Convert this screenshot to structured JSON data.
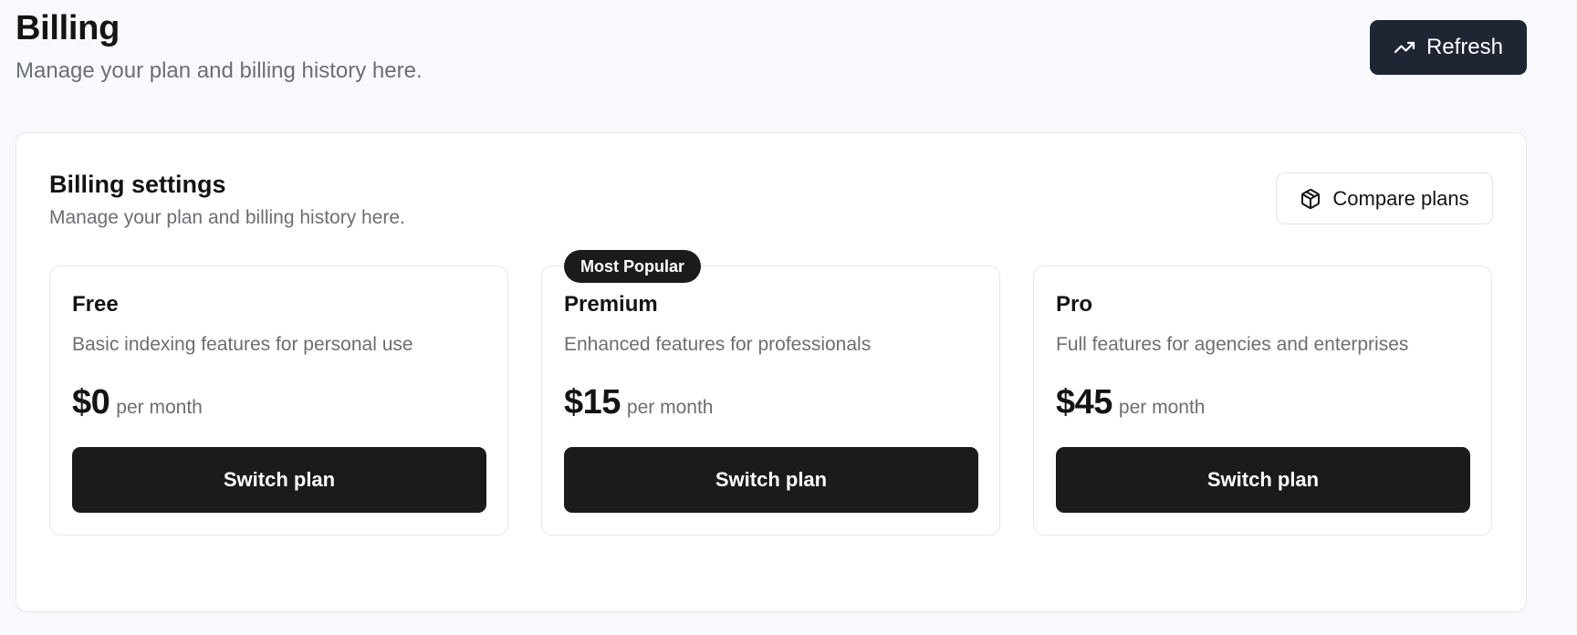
{
  "header": {
    "title": "Billing",
    "subtitle": "Manage your plan and billing history here.",
    "refresh_label": "Refresh",
    "refresh_icon": "trending-up-icon"
  },
  "settings": {
    "title": "Billing settings",
    "subtitle": "Manage your plan and billing history here.",
    "compare_label": "Compare plans",
    "compare_icon": "package-icon"
  },
  "plans": [
    {
      "name": "Free",
      "description": "Basic indexing features for personal use",
      "price": "$0",
      "period": "per month",
      "button_label": "Switch plan",
      "badge": ""
    },
    {
      "name": "Premium",
      "description": "Enhanced features for professionals",
      "price": "$15",
      "period": "per month",
      "button_label": "Switch plan",
      "badge": "Most Popular"
    },
    {
      "name": "Pro",
      "description": "Full features for agencies and enterprises",
      "price": "$45",
      "period": "per month",
      "button_label": "Switch plan",
      "badge": ""
    }
  ],
  "colors": {
    "background": "#f8f9fc",
    "primary_dark": "#1b1b1b",
    "refresh_button": "#1e2533",
    "muted_text": "#6b6e75",
    "border": "#e5e7eb"
  }
}
